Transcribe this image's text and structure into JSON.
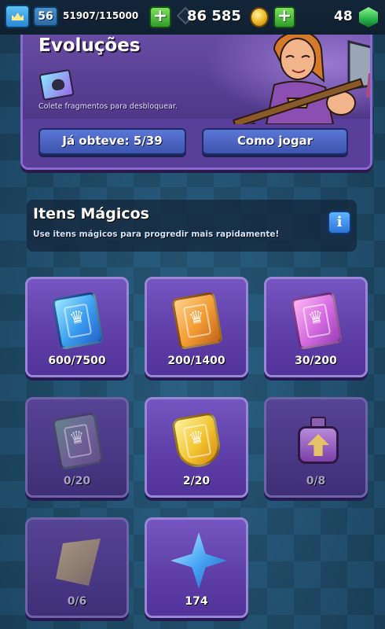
{
  "top_bar": {
    "level": "56",
    "xp": "51907/115000",
    "gold": "86 585",
    "gems": "48",
    "plus_label": "+"
  },
  "evolutions": {
    "title": "Evoluções",
    "description": "Colete fragmentos para desbloquear.",
    "obtained_button": "Já obteve: 5/39",
    "how_to_play_button": "Como jogar"
  },
  "magic_items": {
    "title": "Itens Mágicos",
    "description": "Use itens mágicos para progredir mais rapidamente!",
    "info_label": "i"
  },
  "items": [
    {
      "icon": "blue-wild-card-icon",
      "count": "600/7500"
    },
    {
      "icon": "orange-wild-card-icon",
      "count": "200/1400"
    },
    {
      "icon": "pink-wild-card-icon",
      "count": "30/200"
    },
    {
      "icon": "faded-wild-card-icon",
      "count": "0/20"
    },
    {
      "icon": "gold-banner-card-icon",
      "count": "2/20"
    },
    {
      "icon": "purple-potion-icon",
      "count": "0/8"
    },
    {
      "icon": "shard-icon",
      "count": "0/6"
    },
    {
      "icon": "blue-star-icon",
      "count": "174"
    }
  ],
  "colors": {
    "panel_purple": "#5a3f9a",
    "button_blue": "#4a66c4",
    "plus_green": "#2f9c2b",
    "background": "#214f6e"
  }
}
